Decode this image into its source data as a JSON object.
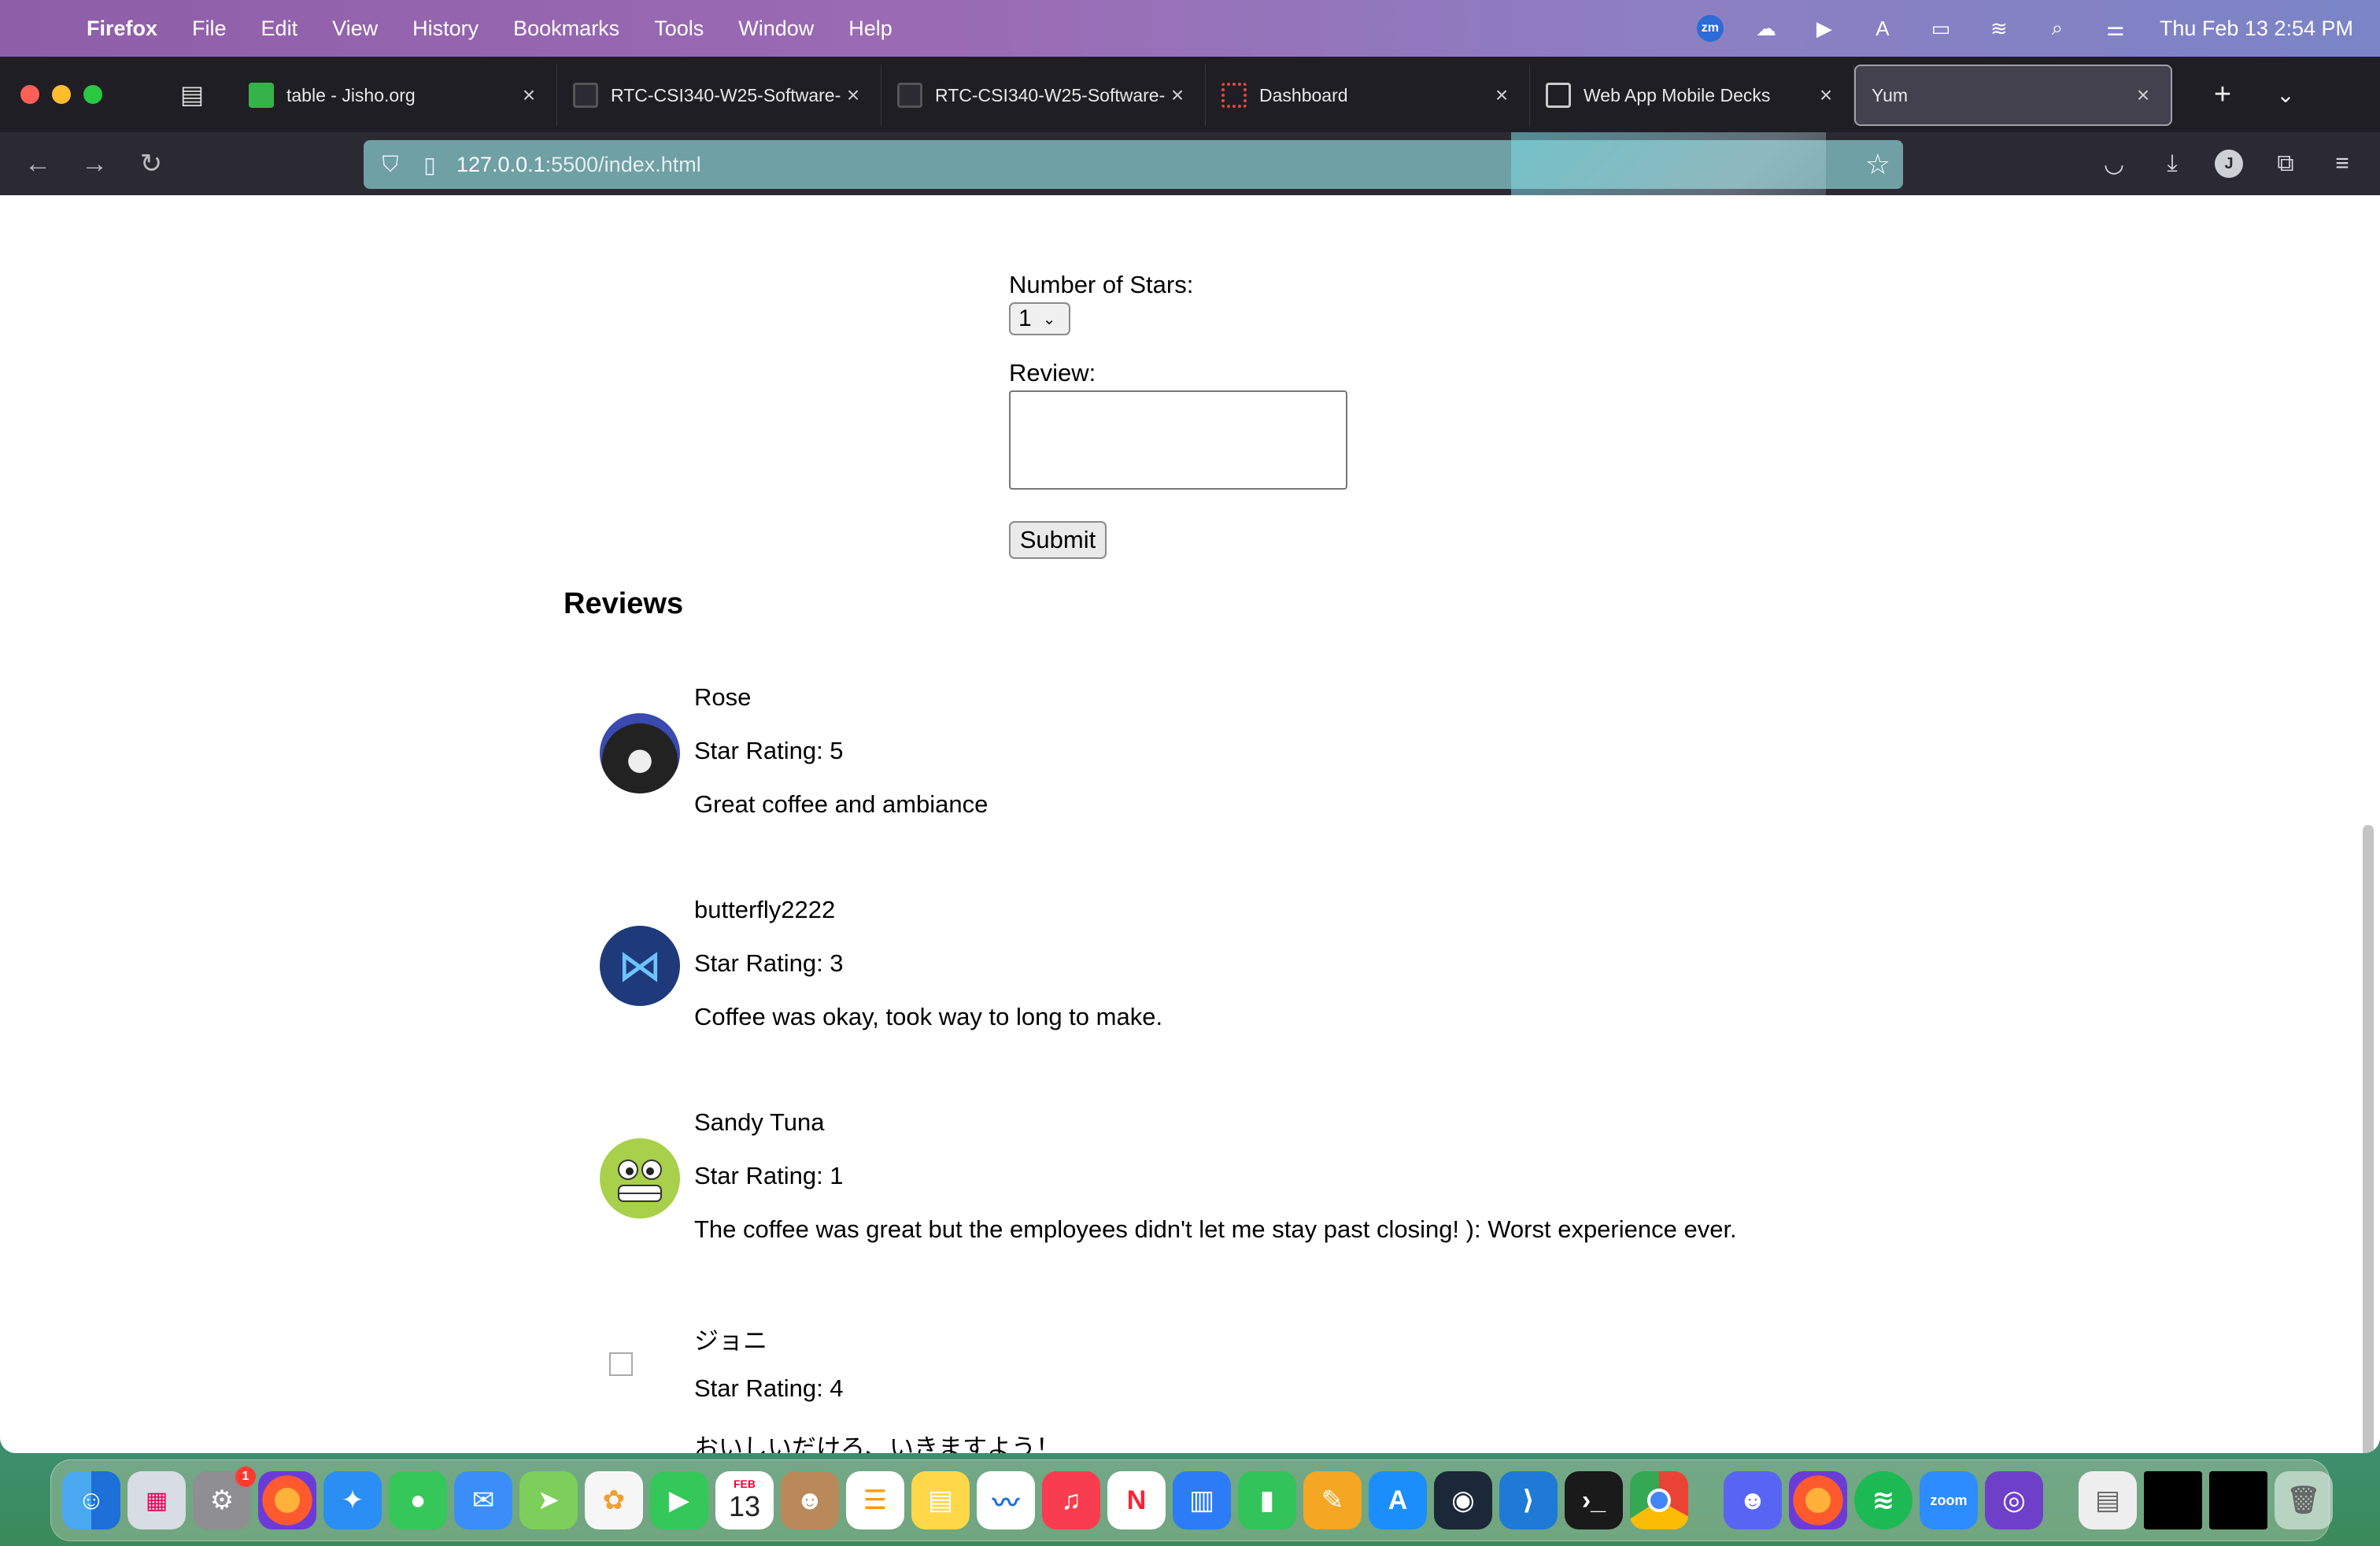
{
  "menubar": {
    "app_name": "Firefox",
    "items": [
      "File",
      "Edit",
      "View",
      "History",
      "Bookmarks",
      "Tools",
      "Window",
      "Help"
    ],
    "zoom_badge": "zm",
    "clock": "Thu Feb 13  2:54 PM"
  },
  "browser": {
    "tabs": [
      {
        "label": "table - Jisho.org"
      },
      {
        "label": "RTC-CSI340-W25-Software-"
      },
      {
        "label": "RTC-CSI340-W25-Software-"
      },
      {
        "label": "Dashboard"
      },
      {
        "label": "Web App Mobile Decks"
      },
      {
        "label": "Yum"
      }
    ],
    "url_host": "127.0.0.1",
    "url_rest": ":5500/index.html",
    "account_initial": "J"
  },
  "form": {
    "stars_label": "Number of Stars:",
    "stars_value": "1",
    "review_label": "Review:",
    "review_value": "",
    "submit_label": "Submit"
  },
  "reviews": {
    "heading": "Reviews",
    "items": [
      {
        "name": "Rose",
        "rating": "Star Rating: 5",
        "text": "Great coffee and ambiance"
      },
      {
        "name": "butterfly2222",
        "rating": "Star Rating: 3",
        "text": "Coffee was okay, took way to long to make."
      },
      {
        "name": "Sandy Tuna",
        "rating": "Star Rating: 1",
        "text": "The coffee was great but the employees didn't let me stay past closing! ): Worst experience ever."
      },
      {
        "name": "ジョニ",
        "rating": "Star Rating: 4",
        "text": "おいしいだけろ、いきますよう！"
      }
    ]
  },
  "dock": {
    "settings_badge": "1",
    "calendar_month": "FEB",
    "calendar_day": "13",
    "zoom_label": "zoom"
  }
}
